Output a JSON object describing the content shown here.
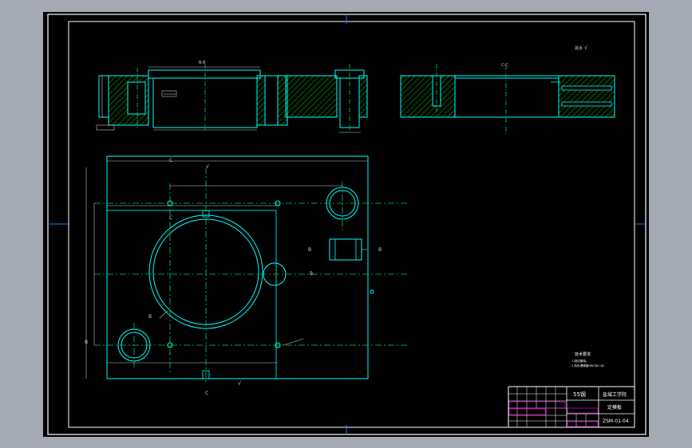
{
  "drawing": {
    "section_label_top_left": "B-B",
    "section_label_top_right": "C-C",
    "roughness_note": "其余",
    "roughness_symbol": "√",
    "section_marker_B": "B",
    "section_marker_C": "C"
  },
  "tech_requirements": {
    "title": "技术要求",
    "line1": "1.锐边倒钝。",
    "line2": "2.热处理硬度HRC58~62"
  },
  "title_block": {
    "material": "55钢",
    "school": "盐城工学院",
    "part_name": "定模板",
    "drawing_number": "ZSM-01-04"
  },
  "colors": {
    "background": "#000000",
    "line": "#00ffff",
    "hatch": "#00ff00",
    "dim": "#c8c8c8",
    "center": "#00cc66",
    "title_magenta": "#ff00ff",
    "title_white": "#ffffff"
  }
}
